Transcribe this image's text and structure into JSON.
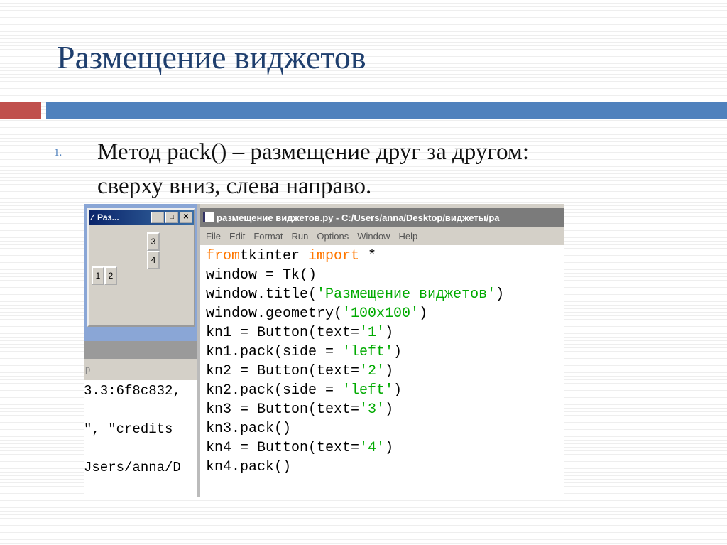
{
  "slide": {
    "title": "Размещение виджетов",
    "item_number": "1.",
    "item_text_line1": "Метод pack() – размещение друг за другом:",
    "item_text_line2": "сверху вниз, слева направо."
  },
  "tk_window": {
    "title": "Раз...",
    "buttons": [
      "1",
      "2",
      "3",
      "4"
    ]
  },
  "shell": {
    "menu_fragment": "p",
    "lines": [
      "3.3:6f8c832,",
      "\", \"credits",
      "Jsers/anna/D"
    ]
  },
  "editor": {
    "title": "размещение виджетов.py - C:/Users/anna/Desktop/виджеты/ра",
    "menu": [
      "File",
      "Edit",
      "Format",
      "Run",
      "Options",
      "Window",
      "Help"
    ],
    "code": [
      [
        [
          "kw",
          "from"
        ],
        [
          "",
          "tkinter "
        ],
        [
          "kw",
          "import"
        ],
        [
          "",
          " *"
        ]
      ],
      [
        [
          "",
          "window = Tk()"
        ]
      ],
      [
        [
          "",
          "window.title("
        ],
        [
          "st",
          "'Размещение виджетов'"
        ],
        [
          "",
          ")"
        ]
      ],
      [
        [
          "",
          "window.geometry("
        ],
        [
          "st",
          "'100x100'"
        ],
        [
          "",
          ")"
        ]
      ],
      [
        [
          "",
          "kn1 = Button(text="
        ],
        [
          "st",
          "'1'"
        ],
        [
          "",
          ")"
        ]
      ],
      [
        [
          "",
          "kn1.pack(side = "
        ],
        [
          "st",
          "'left'"
        ],
        [
          "",
          ")"
        ]
      ],
      [
        [
          "",
          "kn2 = Button(text="
        ],
        [
          "st",
          "'2'"
        ],
        [
          "",
          ")"
        ]
      ],
      [
        [
          "",
          "kn2.pack(side = "
        ],
        [
          "st",
          "'left'"
        ],
        [
          "",
          ")"
        ]
      ],
      [
        [
          "",
          "kn3 = Button(text="
        ],
        [
          "st",
          "'3'"
        ],
        [
          "",
          ")"
        ]
      ],
      [
        [
          "",
          "kn3.pack()"
        ]
      ],
      [
        [
          "",
          "kn4 = Button(text="
        ],
        [
          "st",
          "'4'"
        ],
        [
          "",
          ")"
        ]
      ],
      [
        [
          "",
          "kn4.pack()"
        ]
      ]
    ]
  }
}
